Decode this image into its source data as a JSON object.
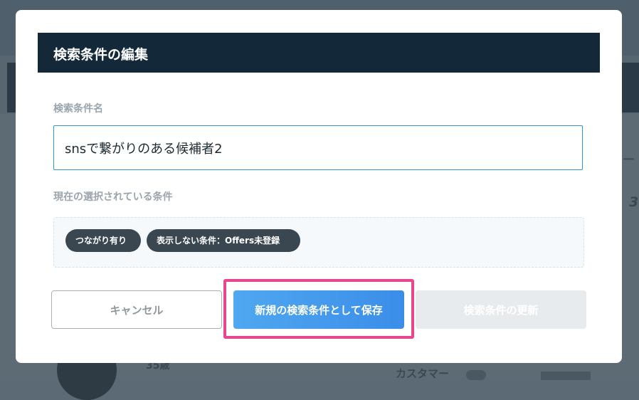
{
  "background": {
    "fragments": [
      "一",
      "3",
      "カスタマー",
      "35歳"
    ]
  },
  "modal": {
    "title": "検索条件の編集",
    "name_label": "検索条件名",
    "name_value": "snsで繋がりのある候補者2",
    "current_label": "現在の選択されている条件",
    "tags": [
      "つながり有り",
      "表示しない条件：Offers未登録"
    ],
    "buttons": {
      "cancel": "キャンセル",
      "save_new": "新規の検索条件として保存",
      "update": "検索条件の更新"
    }
  },
  "colors": {
    "header_bg": "#13293a",
    "primary": "#3b8de8",
    "highlight": "#e8478f",
    "tag_bg": "#3a4750"
  }
}
